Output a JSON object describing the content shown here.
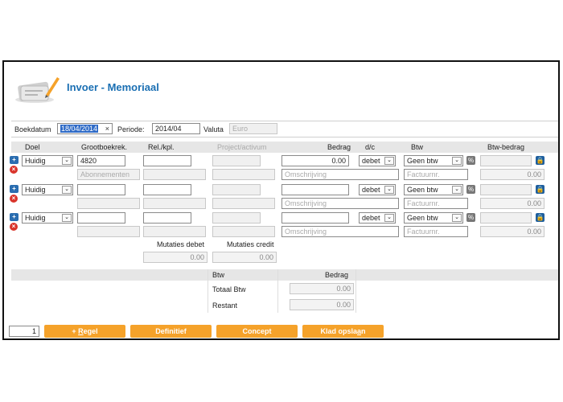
{
  "header": {
    "title": "Invoer - Memoriaal"
  },
  "meta": {
    "boekdatum_label": "Boekdatum",
    "boekdatum_value": "18/04/2014",
    "clear_glyph": "×",
    "periode_label": "Periode:",
    "periode_value": "2014/04",
    "valuta_label": "Valuta",
    "valuta_value": "Euro"
  },
  "columns": {
    "doel": "Doel",
    "grootboek": "Grootboekrek.",
    "rel": "Rel./kpl.",
    "project": "Project/activum",
    "bedrag": "Bedrag",
    "dc": "d/c",
    "btw": "Btw",
    "btw_bedrag": "Btw-bedrag"
  },
  "rows": [
    {
      "doel": "Huidig",
      "grootboek": "4820",
      "grootboek_desc": "Abonnementen",
      "bedrag": "0.00",
      "omschrijving_placeholder": "Omschrijving",
      "dc": "debet",
      "btw": "Geen btw",
      "factuur_placeholder": "Factuurnr.",
      "btw_bedrag_total": "0.00"
    },
    {
      "doel": "Huidig",
      "grootboek": "",
      "grootboek_desc": "",
      "bedrag": "",
      "omschrijving_placeholder": "Omschrijving",
      "dc": "debet",
      "btw": "Geen btw",
      "factuur_placeholder": "Factuurnr.",
      "btw_bedrag_total": "0.00"
    },
    {
      "doel": "Huidig",
      "grootboek": "",
      "grootboek_desc": "",
      "bedrag": "",
      "omschrijving_placeholder": "Omschrijving",
      "dc": "debet",
      "btw": "Geen btw",
      "factuur_placeholder": "Factuurnr.",
      "btw_bedrag_total": "0.00"
    }
  ],
  "icons": {
    "add": "+",
    "delete": "×",
    "percent": "%",
    "lock": "🔒",
    "chevron": "⌄"
  },
  "mutaties": {
    "debet_label": "Mutaties debet",
    "credit_label": "Mutaties credit",
    "debet_value": "0.00",
    "credit_value": "0.00"
  },
  "summary": {
    "btw_header": "Btw",
    "bedrag_header": "Bedrag",
    "totaal_btw_label": "Totaal Btw",
    "totaal_btw_value": "0.00",
    "restant_label": "Restant",
    "restant_value": "0.00"
  },
  "footer": {
    "page": "1",
    "regel_prefix": "+ ",
    "regel_u": "R",
    "regel_rest": "egel",
    "definitief": "Definitief",
    "concept": "Concept",
    "klad_main": "Klad opsla",
    "klad_u": "a",
    "klad_end": "n"
  },
  "colors": {
    "accent": "#1a6fb3",
    "button": "#f5a22a",
    "add_icon": "#2a6db0",
    "delete_icon": "#d9342b"
  }
}
